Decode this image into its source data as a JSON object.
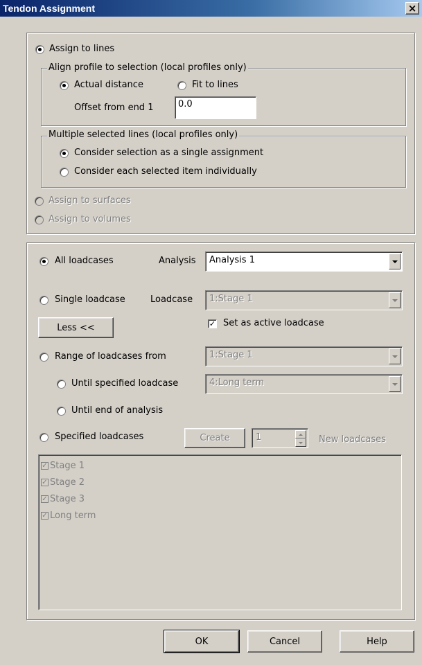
{
  "window": {
    "title": "Tendon Assignment",
    "close_glyph": "×"
  },
  "assign": {
    "to_lines": "Assign to lines",
    "to_surfaces": "Assign to surfaces",
    "to_volumes": "Assign to volumes",
    "selected": "lines"
  },
  "align_group": {
    "legend": "Align profile to selection (local profiles only)",
    "actual_distance": "Actual distance",
    "fit_to_lines": "Fit to lines",
    "selected": "actual_distance",
    "offset_label": "Offset from end 1",
    "offset_value": "0.0"
  },
  "multi_group": {
    "legend": "Multiple selected lines (local profiles only)",
    "single_assignment": "Consider selection as a single assignment",
    "individually": "Consider each selected item individually",
    "selected": "single_assignment"
  },
  "loadcases": {
    "all": "All loadcases",
    "analysis_label": "Analysis",
    "analysis_value": "Analysis 1",
    "single": "Single loadcase",
    "loadcase_label": "Loadcase",
    "loadcase_value": "1:Stage 1",
    "less_button": "Less <<",
    "set_active": "Set as active loadcase",
    "set_active_checked": true,
    "range_from": "Range of loadcases from",
    "range_from_value": "1:Stage 1",
    "until_specified": "Until specified loadcase",
    "until_value": "4:Long term",
    "until_end": "Until end of analysis",
    "specified": "Specified loadcases",
    "create_button": "Create",
    "spin_value": "1",
    "new_loadcases": "New loadcases",
    "selected": "all",
    "list": [
      "Stage 1",
      "Stage 2",
      "Stage 3",
      "Long term"
    ]
  },
  "buttons": {
    "ok": "OK",
    "cancel": "Cancel",
    "help": "Help"
  },
  "icons": {
    "check_glyph": "✓"
  }
}
